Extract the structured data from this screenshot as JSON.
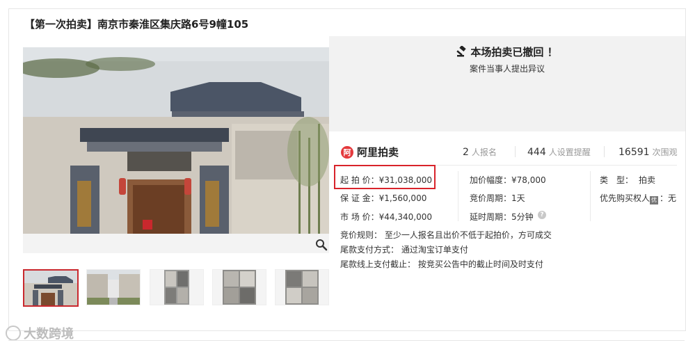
{
  "listing": {
    "title": "【第一次拍卖】南京市秦淮区集庆路6号9幢105"
  },
  "status": {
    "title": "本场拍卖已撤回 ！",
    "reason": "案件当事人提出异议"
  },
  "brand": {
    "logo_text": "阿",
    "name": "阿里拍卖"
  },
  "stats": {
    "signups": "2",
    "signups_label": "人报名",
    "reminders": "444",
    "reminders_label": "人设置提醒",
    "views": "16591",
    "views_label": "次围观"
  },
  "fields": {
    "start_price": "起 拍 价：¥31,038,000",
    "deposit": "保 证 金：¥1,560,000",
    "market_price": "市 场 价：¥44,340,000",
    "increment": "加价幅度：¥78,000",
    "cycle": "竞价周期：1天",
    "delay": "延时周期：5分钟",
    "type_label": "类　型：",
    "type_value": "拍卖",
    "priority_label": "优先购买权人",
    "priority_badge": "优",
    "priority_value": "：无",
    "help_glyph": "?"
  },
  "rules": {
    "bid_rule": "竞价规则： 至少一人报名且出价不低于起拍价，方可成交",
    "payment": "尾款支付方式： 通过淘宝订单支付",
    "deadline": "尾款线上支付截止： 按竞买公告中的截止时间及时支付"
  },
  "watermark": {
    "text": "大数跨境"
  },
  "colors": {
    "highlight": "#d8232a",
    "brand": "#e4393c"
  },
  "gallery": {
    "thumbnail_count": 5,
    "active_index": 0
  }
}
